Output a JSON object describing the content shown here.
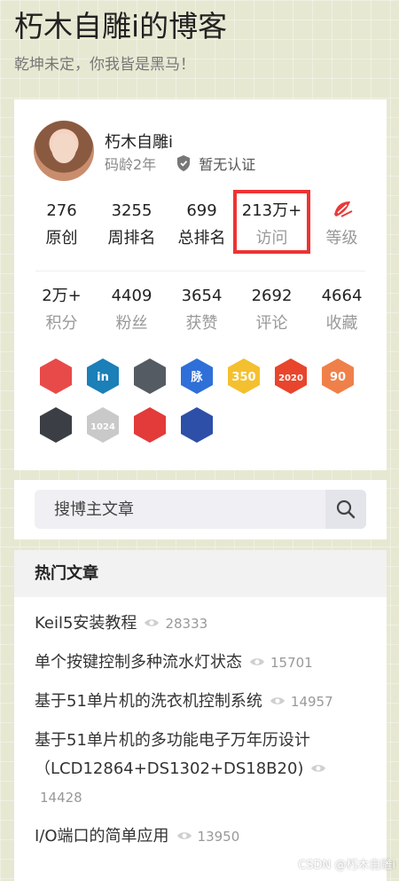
{
  "blog": {
    "title": "朽木自雕i的博客",
    "subtitle": "乾坤未定，你我皆是黑马！"
  },
  "profile": {
    "name": "朽木自雕i",
    "code_age": "码龄2年",
    "certification": "暂无认证",
    "stats_row1": [
      {
        "value": "276",
        "label": "原创"
      },
      {
        "value": "3255",
        "label": "周排名"
      },
      {
        "value": "699",
        "label": "总排名"
      },
      {
        "value": "213万+",
        "label": "访问"
      },
      {
        "value": "",
        "label": "等级"
      }
    ],
    "stats_row2": [
      {
        "value": "2万+",
        "label": "积分"
      },
      {
        "value": "4409",
        "label": "粉丝"
      },
      {
        "value": "3654",
        "label": "获赞"
      },
      {
        "value": "2692",
        "label": "评论"
      },
      {
        "value": "4664",
        "label": "收藏"
      }
    ],
    "badges": [
      {
        "icon": "monkey-badge-icon",
        "color": "#e84a4a",
        "text": ""
      },
      {
        "icon": "linkedin-badge-icon",
        "color": "#1b7fb8",
        "text": "in"
      },
      {
        "icon": "github-badge-icon",
        "color": "#555b63",
        "text": ""
      },
      {
        "icon": "maimai-badge-icon",
        "color": "#2f6fd8",
        "text": "脉"
      },
      {
        "icon": "350-days-badge-icon",
        "color": "#f4c030",
        "text": "350"
      },
      {
        "icon": "2020-badge-icon",
        "color": "#e8452c",
        "text": "2020"
      },
      {
        "icon": "90s-badge-icon",
        "color": "#f0804a",
        "text": "90"
      },
      {
        "icon": "code-badge-icon",
        "color": "#3b3f45",
        "text": ""
      },
      {
        "icon": "1024-badge-icon",
        "color": "#c9c9c9",
        "text": "1024"
      },
      {
        "icon": "pen-badge-icon",
        "color": "#e33a3a",
        "text": ""
      },
      {
        "icon": "rocket-badge-icon",
        "color": "#2d4fa8",
        "text": ""
      }
    ]
  },
  "search": {
    "placeholder": "搜博主文章"
  },
  "hot": {
    "title": "热门文章",
    "items": [
      {
        "title": "Keil5安装教程",
        "views": "28333"
      },
      {
        "title": "单个按键控制多种流水灯状态",
        "views": "15701"
      },
      {
        "title": "基于51单片机的洗衣机控制系统",
        "views": "14957"
      },
      {
        "title": "基于51单片机的多功能电子万年历设计（LCD12864+DS1302+DS18B20)",
        "views": "14428"
      },
      {
        "title": "I/O端口的简单应用",
        "views": "13950"
      }
    ]
  },
  "watermark": "CSDN @朽木自雕i"
}
